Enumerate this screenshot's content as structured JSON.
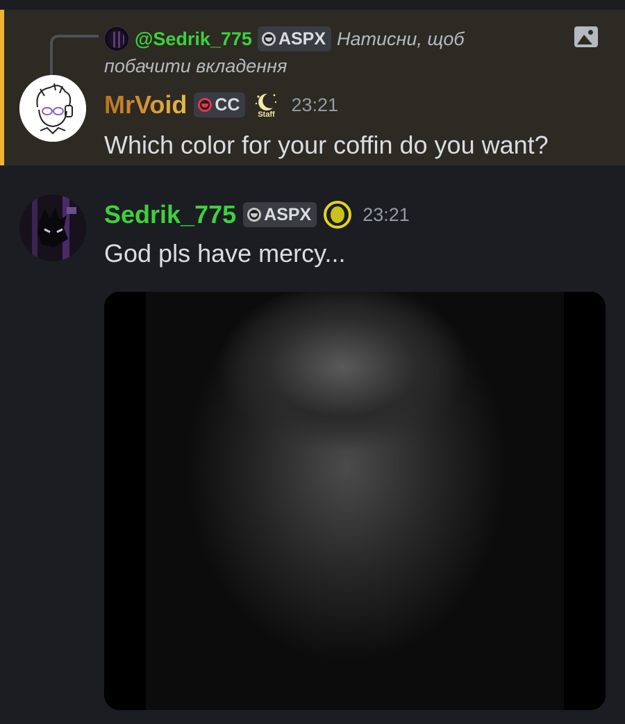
{
  "reply": {
    "author": "@Sedrik_775",
    "role": "ASPX",
    "preview_line1": "Натисни, щоб",
    "preview_line2": "побачити вкладення"
  },
  "messages": [
    {
      "author": "MrVoid",
      "role": "CC",
      "badge": "Staff",
      "time": "23:21",
      "text": "Which color for your coffin do you want?"
    },
    {
      "author": "Sedrik_775",
      "role": "ASPX",
      "time": "23:21",
      "text": "God pls have mercy..."
    }
  ],
  "colors": {
    "mention_bg": "#2c2a23",
    "mention_accent": "#f0b232",
    "sedrik_name": "#3ed13b",
    "mrvoid_name": "#d79a3a"
  },
  "icons": {
    "attachment": "image-icon",
    "role_aspx": "role-dot-gray",
    "role_cc": "role-dot-red",
    "badge_sedrik": "moon-badge"
  }
}
